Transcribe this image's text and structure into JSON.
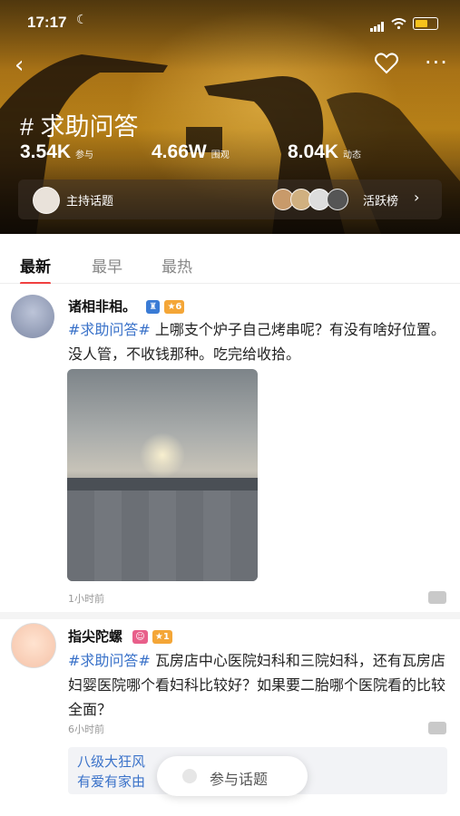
{
  "status_bar": {
    "time": "17:17"
  },
  "header": {
    "topic_title": "# 求助问答",
    "stats": [
      {
        "value": "3.54K",
        "label": "参与"
      },
      {
        "value": "4.66W",
        "label": "围观"
      },
      {
        "value": "8.04K",
        "label": "动态"
      }
    ],
    "host_label": "主持话题",
    "active_label": "活跃榜"
  },
  "tabs": [
    {
      "label": "最新",
      "active": true
    },
    {
      "label": "最早",
      "active": false
    },
    {
      "label": "最热",
      "active": false
    }
  ],
  "posts": [
    {
      "user": "诸相非相。",
      "level": "6",
      "tag": "#求助问答#",
      "text": " 上哪支个炉子自己烤串呢？有没有啥好位置。没人管，不收钱那种。吃完给收拾。",
      "time": "1小时前"
    },
    {
      "user": "指尖陀螺",
      "level": "1",
      "tag": "#求助问答#",
      "text": " 瓦房店中心医院妇科和三院妇科，还有瓦房店妇婴医院哪个看妇科比较好？如果要二胎哪个医院看的比较全面？",
      "time": "6小时前",
      "quote_line1": "八级大狂风",
      "quote_line2": "有爱有家由"
    }
  ],
  "join_button": "参与话题",
  "colors": {
    "accent": "#f04040",
    "tag_blue": "#3a72c9",
    "level_orange": "#f4a637"
  }
}
